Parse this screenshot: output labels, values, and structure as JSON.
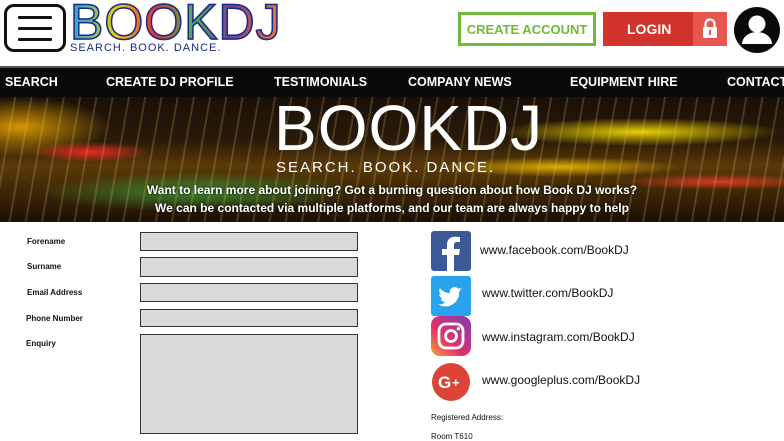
{
  "header": {
    "logo_text": "BOOKDJ",
    "logo_tagline": "SEARCH.  BOOK.  DANCE.",
    "create_account_label": "CREATE ACCOUNT",
    "login_label": "LOGIN"
  },
  "nav": {
    "items": [
      "SEARCH",
      "CREATE DJ PROFILE",
      "TESTIMONIALS",
      "COMPANY NEWS",
      "EQUIPMENT HIRE",
      "CONTACT"
    ]
  },
  "hero": {
    "logo_text": "BOOKDJ",
    "logo_tagline": "SEARCH.   BOOK.   DANCE.",
    "line1": "Want to learn more about joining? Got a burning question about how Book DJ works?",
    "line2": "We can be contacted via multiple platforms, and our team are always happy to help"
  },
  "form": {
    "labels": [
      "Forename",
      "Surname",
      "Email Address",
      "Phone Number",
      "Enquiry"
    ],
    "values": [
      "",
      "",
      "",
      "",
      ""
    ]
  },
  "social": [
    {
      "icon": "facebook-icon",
      "color": "#3b5998",
      "link": "www.facebook.com/BookDJ"
    },
    {
      "icon": "twitter-icon",
      "color": "#2aa3ef",
      "link": "www.twitter.com/BookDJ"
    },
    {
      "icon": "instagram-icon",
      "color": "#c13584",
      "link": "www.instagram.com/BookDJ"
    },
    {
      "icon": "googleplus-icon",
      "color": "#db4437",
      "link": "www.googleplus.com/BookDJ"
    }
  ],
  "address": {
    "heading": "Registered Address:",
    "line1": "Room T610"
  },
  "colors": {
    "create_account": "#6fba38",
    "login": "#d0342c",
    "nav_bg": "#0a0a0a"
  }
}
